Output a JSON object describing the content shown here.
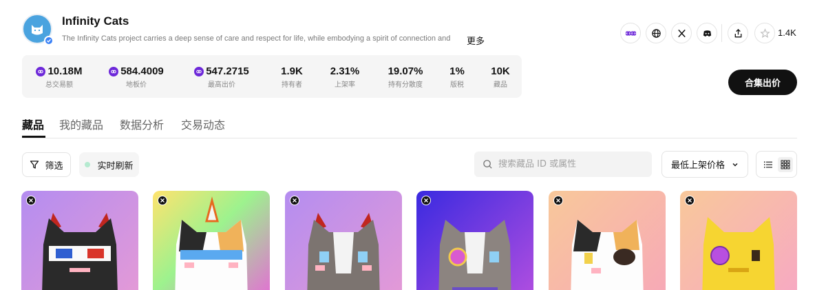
{
  "header": {
    "title": "Infinity Cats",
    "description": "The Infinity Cats project carries a deep sense of care and respect for life, while embodying a spirit of connection and",
    "more_label": "更多",
    "favorite_count": "1.4K"
  },
  "stats": [
    {
      "value": "10.18M",
      "label": "总交易额",
      "coin": true
    },
    {
      "value": "584.4009",
      "label": "地板价",
      "coin": true
    },
    {
      "value": "547.2715",
      "label": "最高出价",
      "coin": true
    },
    {
      "value": "1.9K",
      "label": "持有者",
      "coin": false
    },
    {
      "value": "2.31%",
      "label": "上架率",
      "coin": false
    },
    {
      "value": "19.07%",
      "label": "持有分散度",
      "coin": false
    },
    {
      "value": "1%",
      "label": "版税",
      "coin": false
    },
    {
      "value": "10K",
      "label": "藏品",
      "coin": false
    }
  ],
  "sell_button": "合集出价",
  "tabs": [
    {
      "label": "藏品",
      "active": true
    },
    {
      "label": "我的藏品",
      "active": false
    },
    {
      "label": "数据分析",
      "active": false
    },
    {
      "label": "交易动态",
      "active": false
    }
  ],
  "toolbar": {
    "filter_label": "筛选",
    "refresh_label": "实时刷新",
    "search_placeholder": "搜索藏品 ID 或属性",
    "sort_label": "最低上架价格"
  },
  "cards": [
    {
      "bg": "purple-pink",
      "cat": "black-devil-3d"
    },
    {
      "bg": "rainbow",
      "cat": "calico-cone"
    },
    {
      "bg": "purple-pink",
      "cat": "gray-devil"
    },
    {
      "bg": "violet",
      "cat": "gray-mask"
    },
    {
      "bg": "peach",
      "cat": "calico-pirate"
    },
    {
      "bg": "peach-pink",
      "cat": "gold-eye"
    }
  ],
  "colors": {
    "accent": "#6d28d9",
    "button_dark": "#111111",
    "avatar_blue": "#4aa3df"
  }
}
